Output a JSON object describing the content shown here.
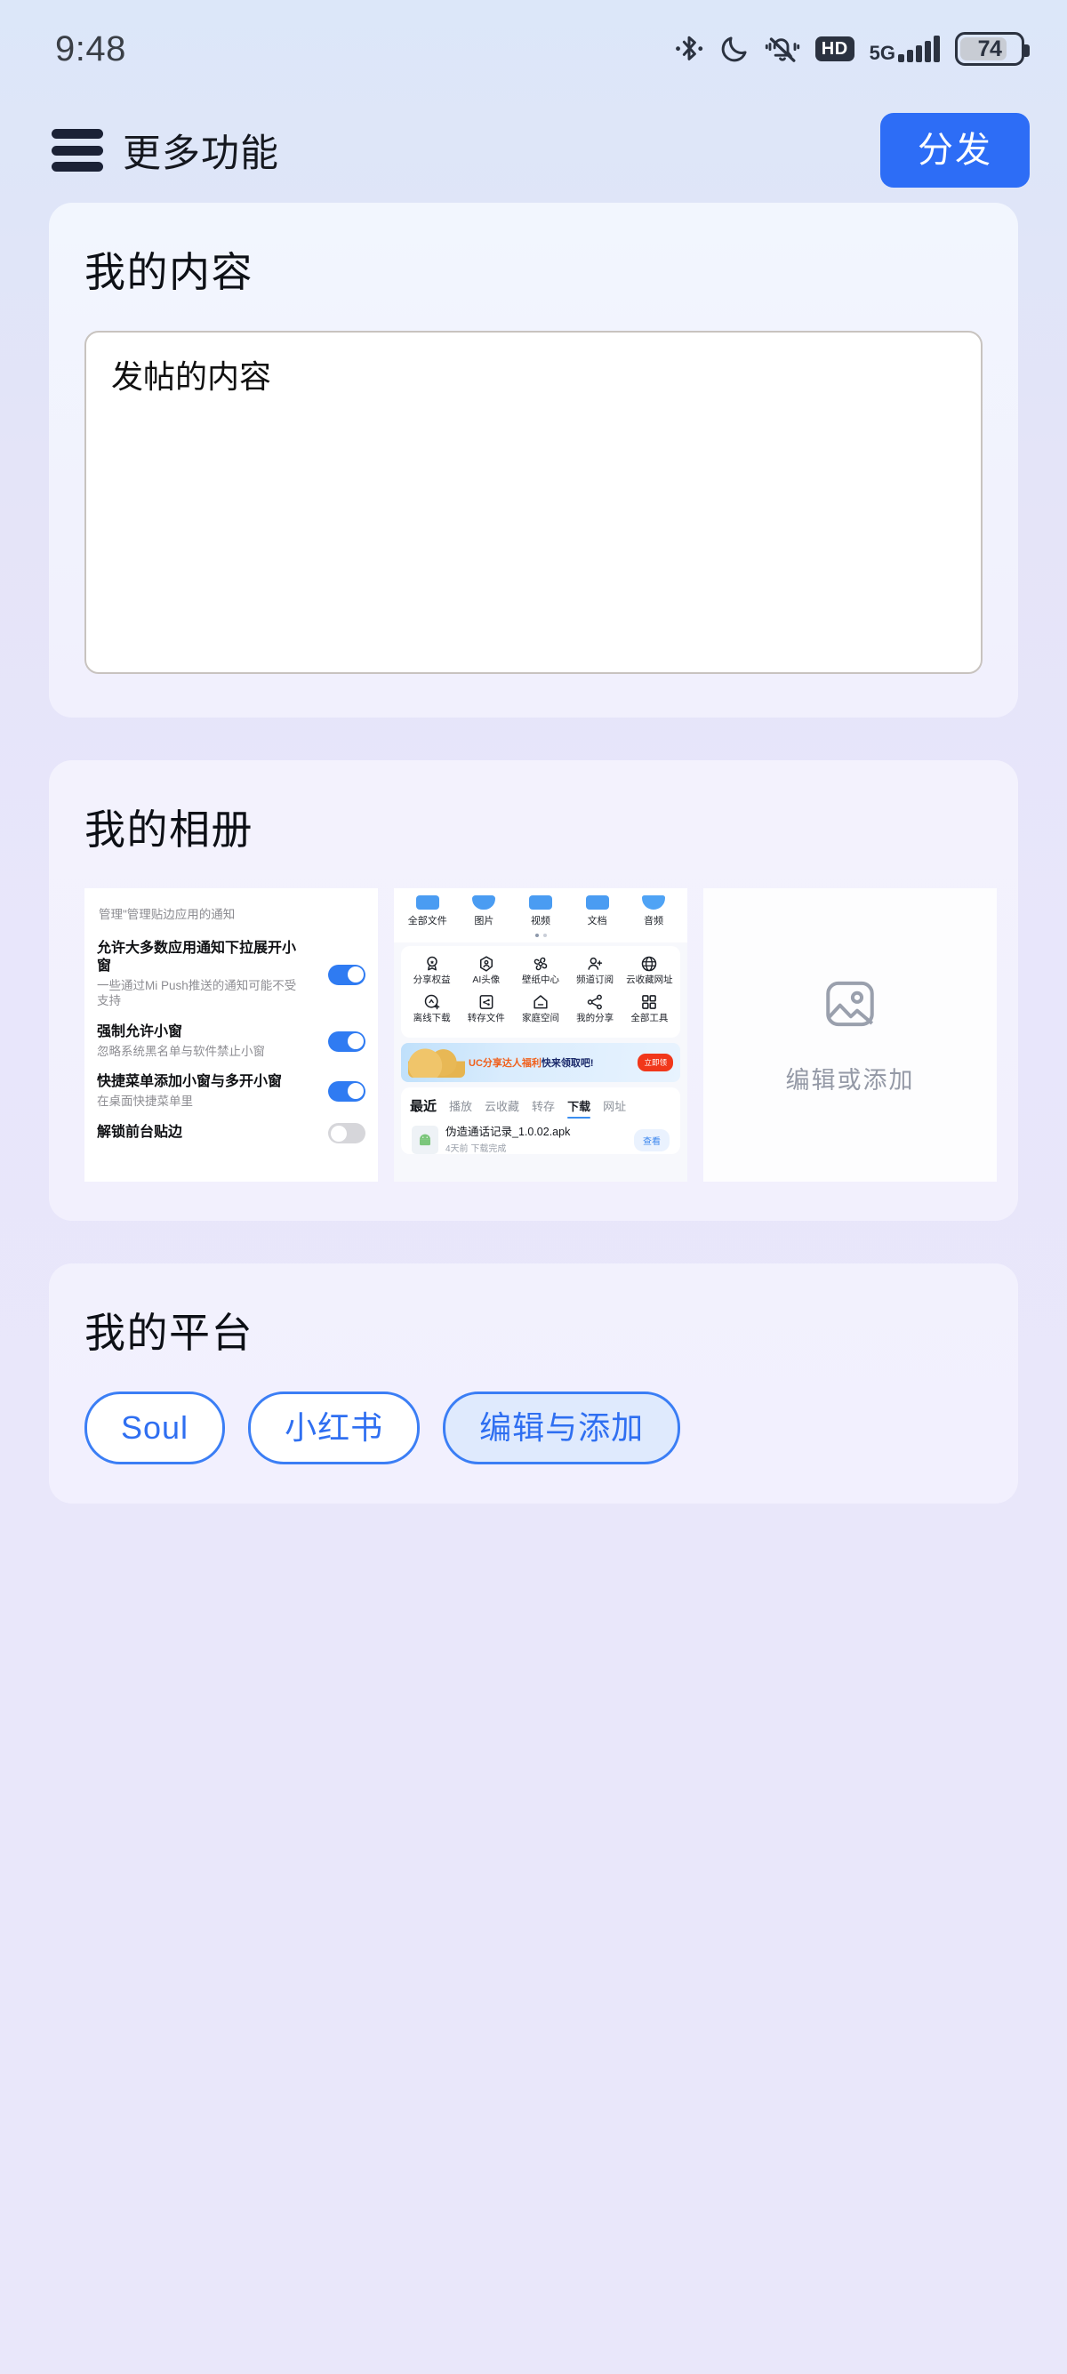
{
  "status_bar": {
    "time": "9:48",
    "battery_level": "74",
    "network_label": "5G",
    "hd_label": "HD",
    "icons": [
      "bluetooth-icon",
      "do-not-disturb-moon-icon",
      "mute-vibrate-bell-icon",
      "hd-icon",
      "5g-signal-icon",
      "battery-icon"
    ]
  },
  "header": {
    "menu_icon": "hamburger-menu-icon",
    "title": "更多功能",
    "primary_button": "分发"
  },
  "content_card": {
    "title": "我的内容",
    "textarea_value": "发帖的内容",
    "textarea_placeholder": "发帖的内容"
  },
  "album_card": {
    "title": "我的相册",
    "thumbnails": [
      {
        "type": "settings-screenshot",
        "header": "管理\"管理贴边应用的通知",
        "rows": [
          {
            "title": "允许大多数应用通知下拉展开小窗",
            "subtitle": "一些通过Mi Push推送的通知可能不受支持",
            "toggle": "on"
          },
          {
            "title": "强制允许小窗",
            "subtitle": "忽略系统黑名单与软件禁止小窗",
            "toggle": "on"
          },
          {
            "title": "快捷菜单添加小窗与多开小窗",
            "subtitle": "在桌面快捷菜单里",
            "toggle": "on"
          },
          {
            "title": "解锁前台贴边",
            "subtitle": "",
            "toggle": "off"
          }
        ]
      },
      {
        "type": "file-manager-screenshot",
        "categories": [
          "全部文件",
          "图片",
          "视频",
          "文档",
          "音频"
        ],
        "tools_row1": [
          "分享权益",
          "AI头像",
          "壁纸中心",
          "频道订阅",
          "云收藏网址"
        ],
        "tools_row2": [
          "离线下载",
          "转存文件",
          "家庭空间",
          "我的分享",
          "全部工具"
        ],
        "banner_text_orange": "UC分享达人福利",
        "banner_text_blue": "快来领取吧!",
        "banner_button": "立即领",
        "tabs": [
          "最近",
          "播放",
          "云收藏",
          "转存",
          "下载",
          "网址"
        ],
        "active_tab": "最近",
        "underlined_tab": "下载",
        "file_name": "伪造通话记录_1.0.02.apk",
        "file_meta": "4天前 下载完成",
        "file_action": "查看"
      },
      {
        "type": "add-placeholder",
        "icon": "image-placeholder-icon",
        "label": "编辑或添加"
      }
    ]
  },
  "platform_card": {
    "title": "我的平台",
    "chips": [
      {
        "label": "Soul",
        "selected": false
      },
      {
        "label": "小红书",
        "selected": false
      },
      {
        "label": "编辑与添加",
        "selected": true
      }
    ]
  },
  "colors": {
    "accent_blue": "#2d6df6",
    "chip_border": "#3b7ef5",
    "chip_selected_bg": "#dfeafd",
    "bg_top": "#dce7f9",
    "bg_bottom": "#e9e7fa",
    "card_bg": "#f2f1fd"
  }
}
